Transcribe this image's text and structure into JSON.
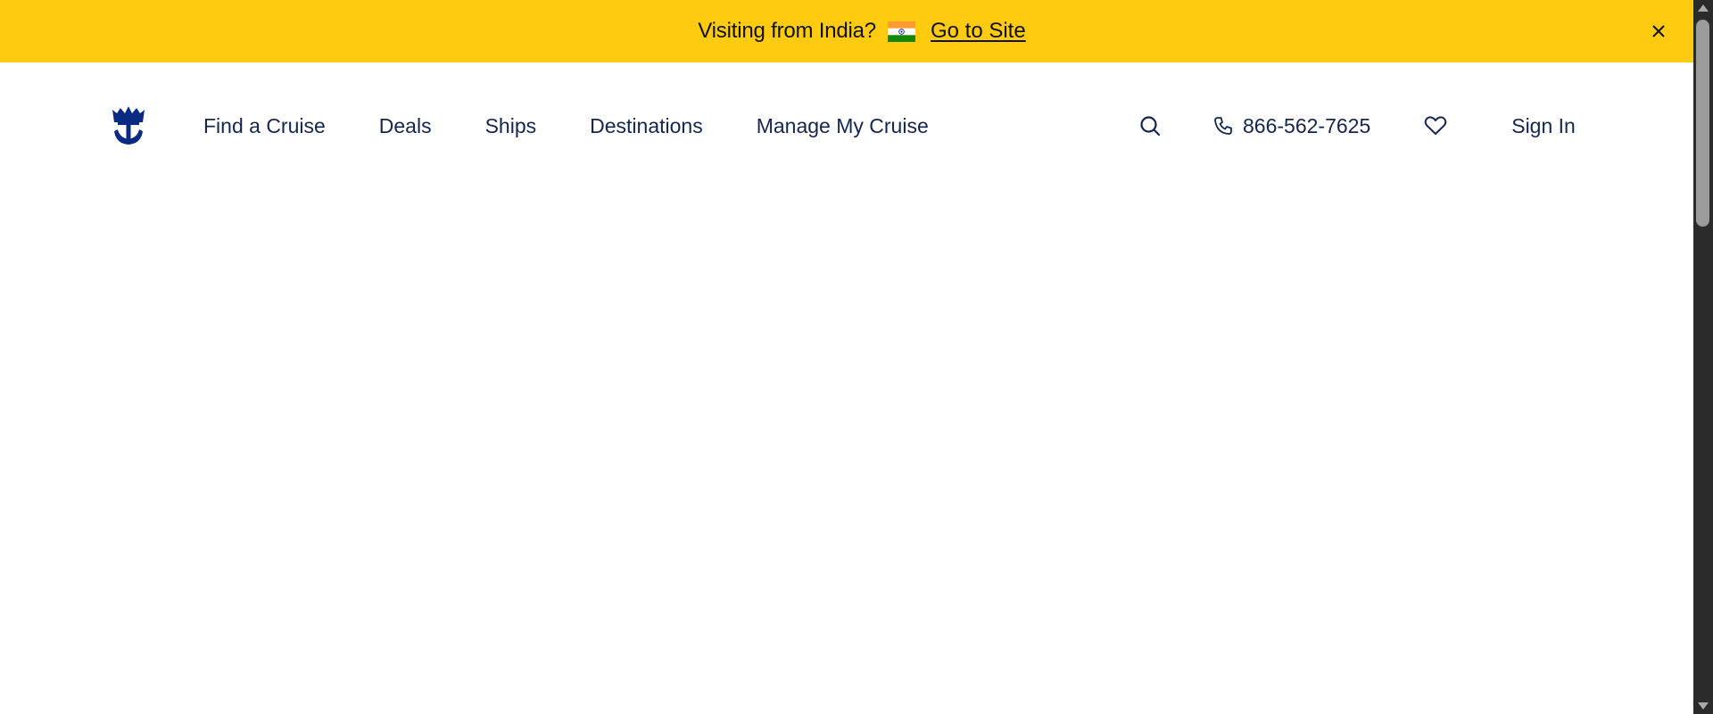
{
  "banner": {
    "text": "Visiting from India?",
    "link_label": "Go to Site",
    "flag_icon": "india-flag-icon",
    "close_icon": "close-icon",
    "background": "#ffcb10"
  },
  "header": {
    "logo_icon": "crown-anchor-logo-icon",
    "nav": [
      {
        "label": "Find a Cruise"
      },
      {
        "label": "Deals"
      },
      {
        "label": "Ships"
      },
      {
        "label": "Destinations"
      },
      {
        "label": "Manage My Cruise"
      }
    ],
    "search_icon": "search-icon",
    "phone": {
      "icon": "phone-icon",
      "number": "866-562-7625"
    },
    "favorites_icon": "heart-icon",
    "sign_in_label": "Sign In",
    "text_color": "#15264e",
    "brand_color": "#0b2a83"
  }
}
